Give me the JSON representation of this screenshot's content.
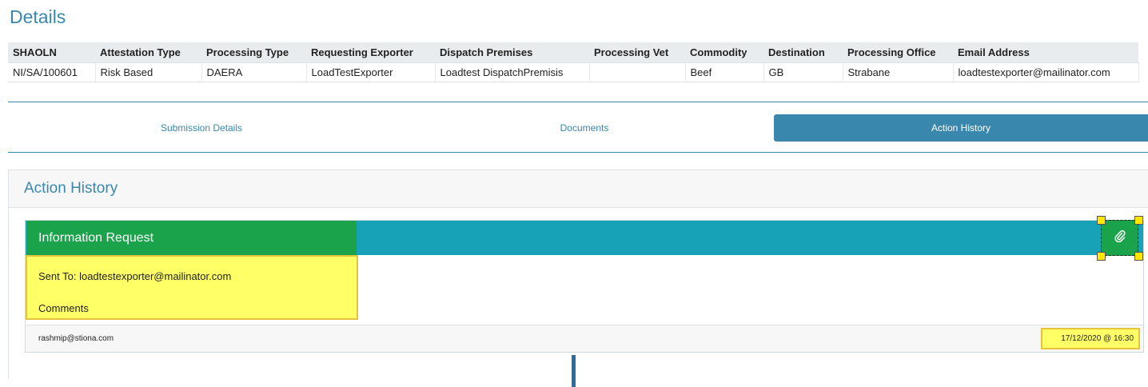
{
  "page": {
    "title": "Details"
  },
  "details_table": {
    "headers": [
      "SHAOLN",
      "Attestation Type",
      "Processing Type",
      "Requesting Exporter",
      "Dispatch Premises",
      "Processing Vet",
      "Commodity",
      "Destination",
      "Processing Office",
      "Email Address"
    ],
    "row": [
      "NI/SA/100601",
      "Risk Based",
      "DAERA",
      "LoadTestExporter",
      "Loadtest DispatchPremisis",
      "",
      "Beef",
      "GB",
      "Strabane",
      "loadtestexporter@mailinator.com"
    ]
  },
  "tabs": [
    {
      "label": "Submission Details"
    },
    {
      "label": "Documents"
    },
    {
      "label": "Action History"
    }
  ],
  "panel": {
    "title": "Action History"
  },
  "card": {
    "title": "Information Request",
    "sent_to": "Sent To: loadtestexporter@mailinator.com",
    "comments": "Comments",
    "author": "rashmip@stiona.com",
    "timestamp": "17/12/2020 @ 16:30"
  },
  "icons": {
    "attachment": "paperclip-icon"
  },
  "colors": {
    "accent": "#3a87ad",
    "card_header": "#17a2b8",
    "highlight_yellow": "#ffff66",
    "highlight_green": "#1aa34a"
  }
}
